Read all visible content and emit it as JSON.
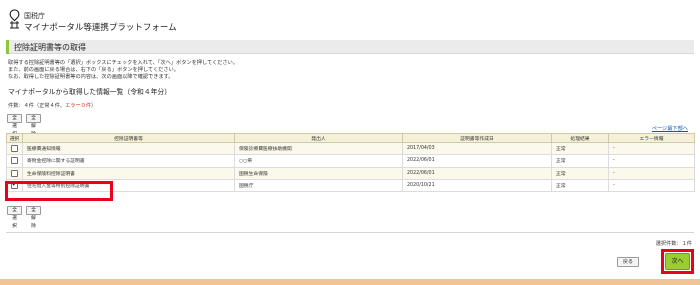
{
  "header": {
    "org": "国税庁",
    "service": "マイナポータル等連携プラットフォーム"
  },
  "page": {
    "title": "控除証明書等の取得"
  },
  "description": [
    "取得する控除証明書等の「選択」ボックスにチェックを入れて、「次へ」ボタンを押してください。",
    "また、前の画面に戻る場合は、右下の「戻る」ボタンを押してください。",
    "なお、取得した控除証明書等の内容は、次の画面以降で確認できます。"
  ],
  "list": {
    "heading": "マイナポータルから取得した情報一覧（令和４年分）",
    "count_prefix": "件数：４件（正常４件、",
    "count_error": "エラー０件",
    "count_suffix": "）",
    "select_all_label": "全選択",
    "deselect_all_label": "全解除",
    "page_link": "ページ最下部へ"
  },
  "table": {
    "headers": [
      "選択",
      "控除証明書等",
      "発出人",
      "証明書等作成日",
      "処理結果",
      "エラー情報"
    ],
    "rows": [
      {
        "checked": false,
        "name": "医療費通知情報",
        "issuer": "保険診療費医療扶助機関",
        "date": "2017/04/03",
        "result": "正常",
        "error": "-"
      },
      {
        "checked": false,
        "name": "寄附金控除に関する証明書",
        "issuer": "○○県",
        "date": "2022/06/01",
        "result": "正常",
        "error": "-"
      },
      {
        "checked": false,
        "name": "生命保険料控除証明書",
        "issuer": "国税生命保険",
        "date": "2022/06/01",
        "result": "正常",
        "error": "-"
      },
      {
        "checked": true,
        "name": "住宅借入金等特別控除証明書",
        "issuer": "国税庁",
        "date": "2020/10/21",
        "result": "正常",
        "error": "-"
      }
    ]
  },
  "footer": {
    "selected_count": "選択件数：１件",
    "back_label": "戻る",
    "next_label": "次へ"
  },
  "colors": {
    "accent_green": "#8cc63f",
    "next_button": "#9acd32",
    "highlight_red": "#e8001c",
    "table_header": "#f5f1d8",
    "footer_bar": "#f2c394"
  }
}
